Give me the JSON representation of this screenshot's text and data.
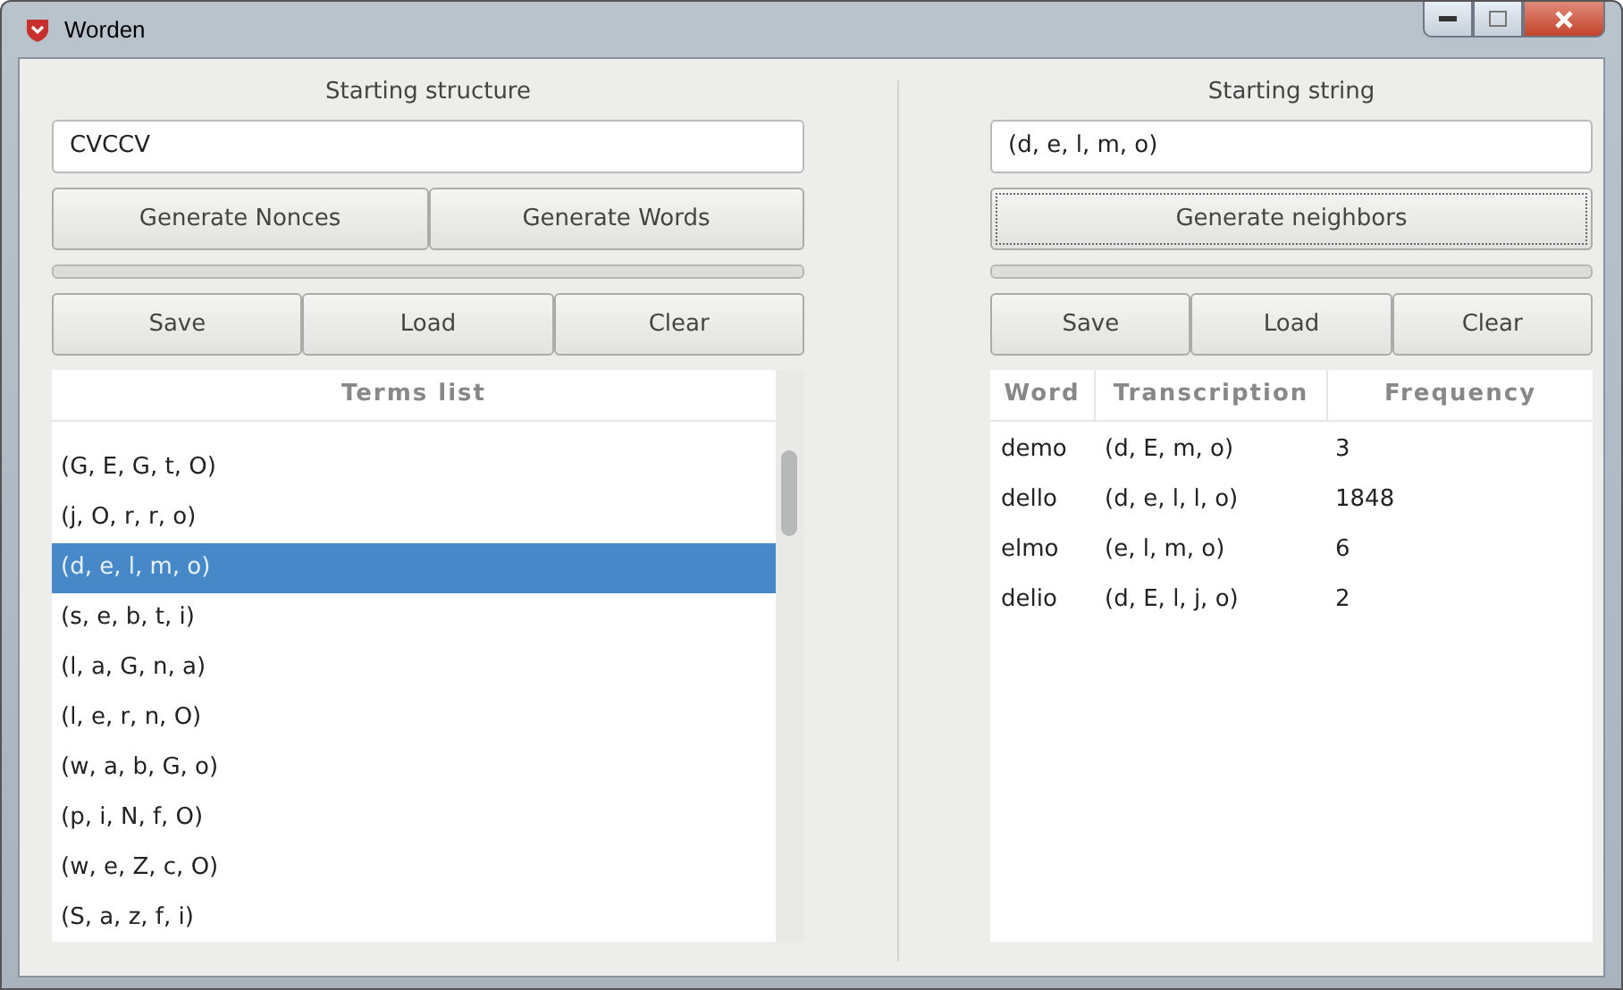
{
  "window": {
    "title": "Worden"
  },
  "left": {
    "label": "Starting structure",
    "input": "CVCCV",
    "generate_buttons": [
      "Generate Nonces",
      "Generate Words"
    ],
    "progress": {
      "level": 0
    },
    "buttons": [
      "Save",
      "Load",
      "Clear"
    ],
    "terms": {
      "heading": "Terms list",
      "items": [
        {
          "text": "(G, E, G, t, O)",
          "selected": false
        },
        {
          "text": "(j, O, r, r, o)",
          "selected": false
        },
        {
          "text": "(d, e, l, m, o)",
          "selected": true
        },
        {
          "text": "(s, e, b, t, i)",
          "selected": false
        },
        {
          "text": "(l, a, G, n, a)",
          "selected": false
        },
        {
          "text": "(l, e, r, n, O)",
          "selected": false
        },
        {
          "text": "(w, a, b, G, o)",
          "selected": false
        },
        {
          "text": "(p, i, N, f, O)",
          "selected": false
        },
        {
          "text": "(w, e, Z, c, O)",
          "selected": false
        },
        {
          "text": "(S, a, z, f, i)",
          "selected": false
        }
      ]
    }
  },
  "right": {
    "label": "Starting string",
    "input": "(d, e, l, m, o)",
    "generate_button": "Generate neighbors",
    "progress": {
      "level": 0
    },
    "buttons": [
      "Save",
      "Load",
      "Clear"
    ],
    "table": {
      "columns": [
        "Word",
        "Transcription",
        "Frequency"
      ],
      "rows": [
        [
          "demo",
          "(d, E, m, o)",
          "3"
        ],
        [
          "dello",
          "(d, e, l, l, o)",
          "1848"
        ],
        [
          "elmo",
          "(e, l, m, o)",
          "6"
        ],
        [
          "delio",
          "(d, E, l, j, o)",
          "2"
        ]
      ]
    }
  }
}
